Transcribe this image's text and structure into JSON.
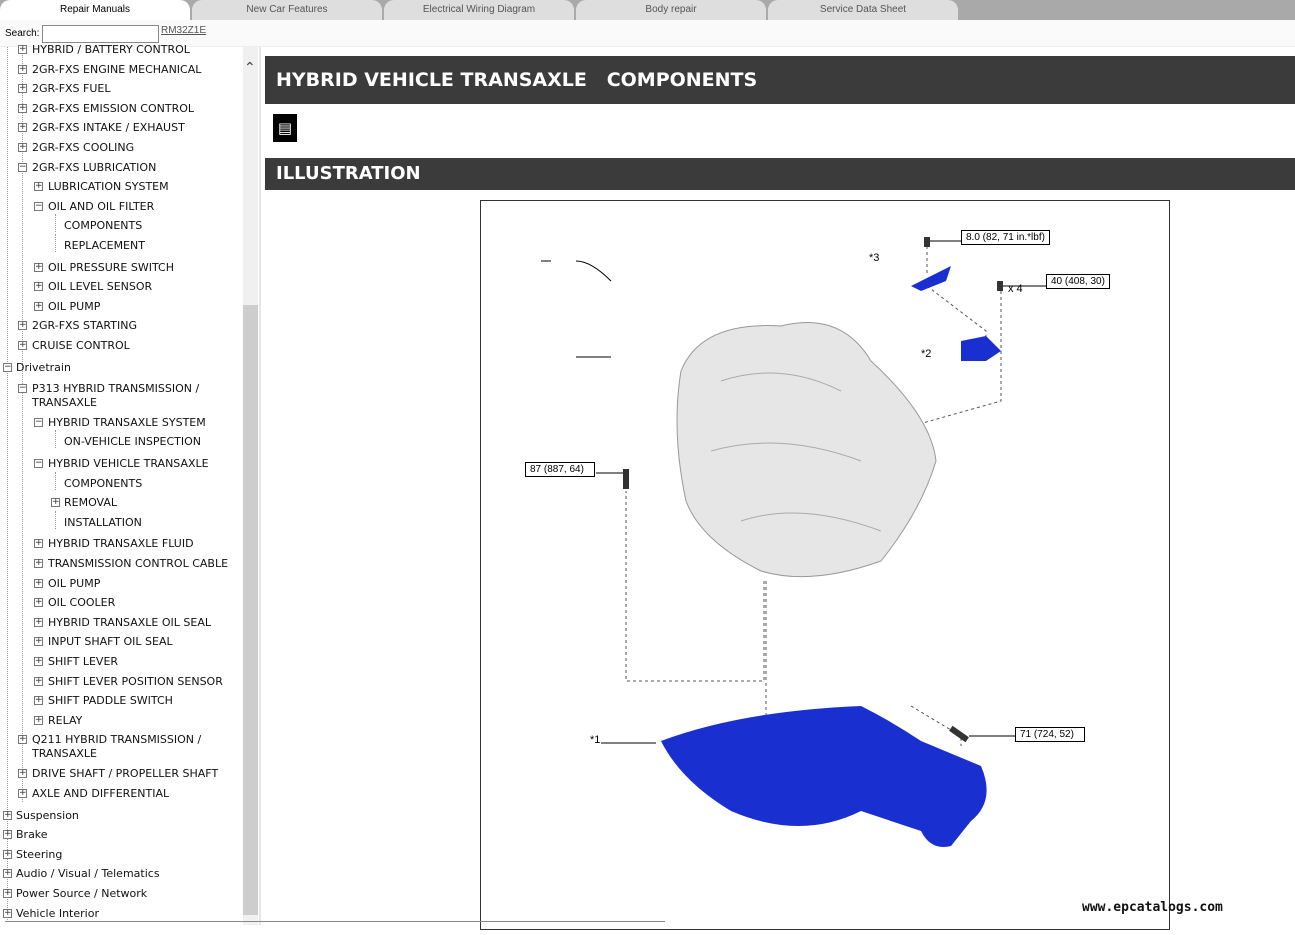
{
  "tabs": [
    "Repair Manuals",
    "New Car Features",
    "Electrical Wiring Diagram",
    "Body repair",
    "Service Data Sheet"
  ],
  "search": {
    "label": "Search:",
    "value": "",
    "code_link": "RM32Z1E"
  },
  "tree": [
    {
      "t": "HYBRID / BATTERY CONTROL",
      "l": 2,
      "b": "+"
    },
    {
      "t": "2GR-FXS ENGINE MECHANICAL",
      "l": 2,
      "b": "+"
    },
    {
      "t": "2GR-FXS FUEL",
      "l": 2,
      "b": "+"
    },
    {
      "t": "2GR-FXS EMISSION CONTROL",
      "l": 2,
      "b": "+"
    },
    {
      "t": "2GR-FXS INTAKE / EXHAUST",
      "l": 2,
      "b": "+"
    },
    {
      "t": "2GR-FXS COOLING",
      "l": 2,
      "b": "+"
    },
    {
      "t": "2GR-FXS LUBRICATION",
      "l": 2,
      "b": "-"
    },
    {
      "t": "LUBRICATION SYSTEM",
      "l": 3,
      "b": "+"
    },
    {
      "t": "OIL AND OIL FILTER",
      "l": 3,
      "b": "-"
    },
    {
      "t": "COMPONENTS",
      "l": 4,
      "b": ""
    },
    {
      "t": "REPLACEMENT",
      "l": 4,
      "b": ""
    },
    {
      "t": "OIL PRESSURE SWITCH",
      "l": 3,
      "b": "+"
    },
    {
      "t": "OIL LEVEL SENSOR",
      "l": 3,
      "b": "+"
    },
    {
      "t": "OIL PUMP",
      "l": 3,
      "b": "+"
    },
    {
      "t": "2GR-FXS STARTING",
      "l": 2,
      "b": "+"
    },
    {
      "t": "CRUISE CONTROL",
      "l": 2,
      "b": "+"
    },
    {
      "t": "Drivetrain",
      "l": 1,
      "b": "-"
    },
    {
      "t": "P313 HYBRID TRANSMISSION / TRANSAXLE",
      "l": 2,
      "b": "-",
      "two": true
    },
    {
      "t": "HYBRID TRANSAXLE SYSTEM",
      "l": 3,
      "b": "-"
    },
    {
      "t": "ON-VEHICLE INSPECTION",
      "l": 4,
      "b": ""
    },
    {
      "t": "HYBRID VEHICLE TRANSAXLE",
      "l": 3,
      "b": "-"
    },
    {
      "t": "COMPONENTS",
      "l": 4,
      "b": ""
    },
    {
      "t": "REMOVAL",
      "l": 4,
      "b": "+"
    },
    {
      "t": "INSTALLATION",
      "l": 4,
      "b": ""
    },
    {
      "t": "HYBRID TRANSAXLE FLUID",
      "l": 3,
      "b": "+"
    },
    {
      "t": "TRANSMISSION CONTROL CABLE",
      "l": 3,
      "b": "+"
    },
    {
      "t": "OIL PUMP",
      "l": 3,
      "b": "+"
    },
    {
      "t": "OIL COOLER",
      "l": 3,
      "b": "+"
    },
    {
      "t": "HYBRID TRANSAXLE OIL SEAL",
      "l": 3,
      "b": "+"
    },
    {
      "t": "INPUT SHAFT OIL SEAL",
      "l": 3,
      "b": "+"
    },
    {
      "t": "SHIFT LEVER",
      "l": 3,
      "b": "+"
    },
    {
      "t": "SHIFT LEVER POSITION SENSOR",
      "l": 3,
      "b": "+"
    },
    {
      "t": "SHIFT PADDLE SWITCH",
      "l": 3,
      "b": "+"
    },
    {
      "t": "RELAY",
      "l": 3,
      "b": "+"
    },
    {
      "t": "Q211 HYBRID TRANSMISSION / TRANSAXLE",
      "l": 2,
      "b": "+",
      "two": true
    },
    {
      "t": "DRIVE SHAFT / PROPELLER SHAFT",
      "l": 2,
      "b": "+"
    },
    {
      "t": "AXLE AND DIFFERENTIAL",
      "l": 2,
      "b": "+"
    },
    {
      "t": "Suspension",
      "l": 1,
      "b": "+"
    },
    {
      "t": "Brake",
      "l": 1,
      "b": "+"
    },
    {
      "t": "Steering",
      "l": 1,
      "b": "+"
    },
    {
      "t": "Audio / Visual / Telematics",
      "l": 1,
      "b": "+"
    },
    {
      "t": "Power Source / Network",
      "l": 1,
      "b": "+"
    },
    {
      "t": "Vehicle Interior",
      "l": 1,
      "b": "+"
    }
  ],
  "main": {
    "title": "HYBRID VEHICLE TRANSAXLE   COMPONENTS",
    "section": "ILLUSTRATION",
    "doc_icon": "document-icon"
  },
  "illustration": {
    "callouts": [
      "8.0 (82, 71 in.*lbf)",
      "40 (408, 30)",
      "87 (887, 64)",
      "71 (724, 52)"
    ],
    "labels": [
      "*3",
      "*2",
      "*1",
      "x 4"
    ]
  },
  "colors": {
    "header_bg": "#3b3b3b",
    "part_blue": "#1a2fd0"
  },
  "watermark": "www.epcatalogs.com"
}
